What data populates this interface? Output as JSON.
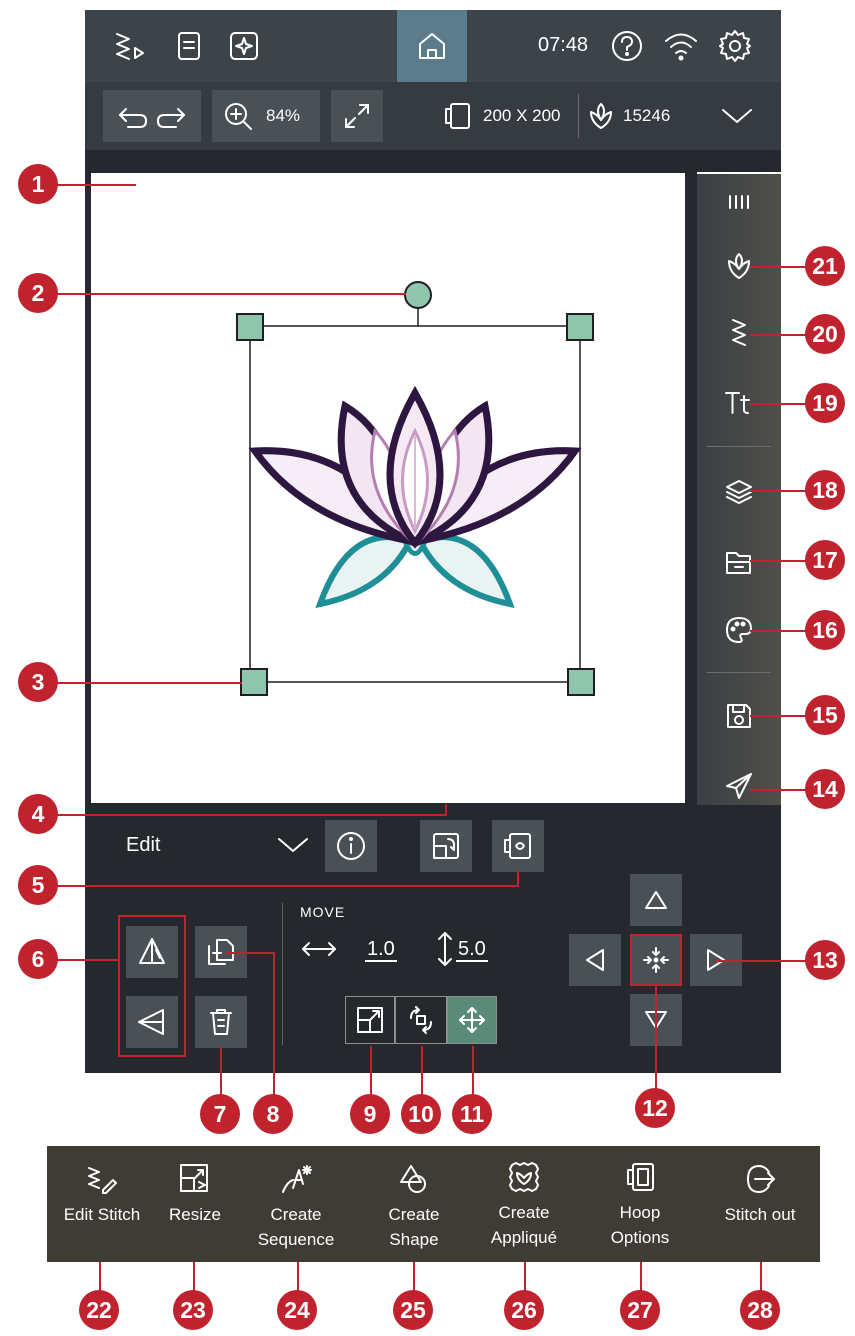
{
  "status": {
    "time": "07:48"
  },
  "toolbar": {
    "zoom": "84%",
    "hoop_size": "200 X 200",
    "stitch_count": "15246"
  },
  "edit_panel": {
    "mode_label": "Edit",
    "move_label": "MOVE",
    "move_x": "1.0",
    "move_y": "5.0"
  },
  "bottom_menu": [
    {
      "label": "Edit Stitch",
      "icon": "edit-stitch-icon"
    },
    {
      "label": "Resize",
      "icon": "resize-icon"
    },
    {
      "label": "Create Sequence",
      "icon": "create-sequence-icon"
    },
    {
      "label": "Create Shape",
      "icon": "create-shape-icon"
    },
    {
      "label": "Create Appliqué",
      "icon": "create-applique-icon"
    },
    {
      "label": "Hoop Options",
      "icon": "hoop-options-icon"
    },
    {
      "label": "Stitch out",
      "icon": "stitch-out-icon"
    }
  ],
  "callouts": [
    "1",
    "2",
    "3",
    "4",
    "5",
    "6",
    "7",
    "8",
    "9",
    "10",
    "11",
    "12",
    "13",
    "14",
    "15",
    "16",
    "17",
    "18",
    "19",
    "20",
    "21",
    "22",
    "23",
    "24",
    "25",
    "26",
    "27",
    "28"
  ],
  "colors": {
    "accent_red": "#c0222e",
    "handle_green": "#8fc4ad",
    "home_blue": "#5b7c8a",
    "lotus_purple": "#2d1640",
    "lotus_teal": "#1e8e97"
  }
}
